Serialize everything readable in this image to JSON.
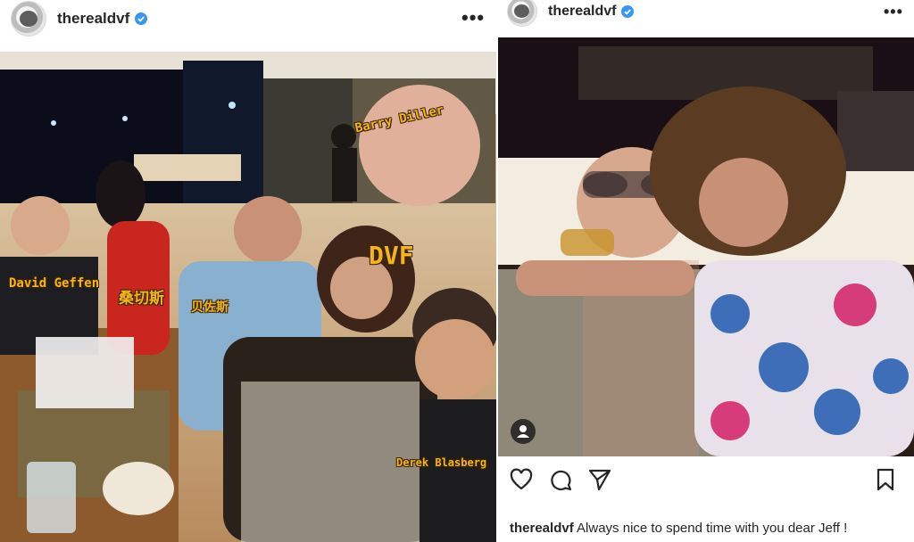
{
  "posts": [
    {
      "username": "therealdvf",
      "more_glyph": "•••",
      "tags": {
        "person_1": "David Geffen",
        "person_2": "桑切斯",
        "person_3": "贝佐斯",
        "person_4": "DVF",
        "person_5": "Barry Diller",
        "person_6": "Derek Blasberg"
      }
    },
    {
      "username": "therealdvf",
      "more_glyph": "•••",
      "caption_user": "therealdvf",
      "caption_text": "Always nice to spend time with you dear Jeff !",
      "action_icons": [
        "heart-icon",
        "comment-icon",
        "share-icon",
        "bookmark-icon"
      ]
    }
  ],
  "colors": {
    "verified": "#3897f0",
    "tag_text": "#f2b51a",
    "text": "#262626"
  }
}
